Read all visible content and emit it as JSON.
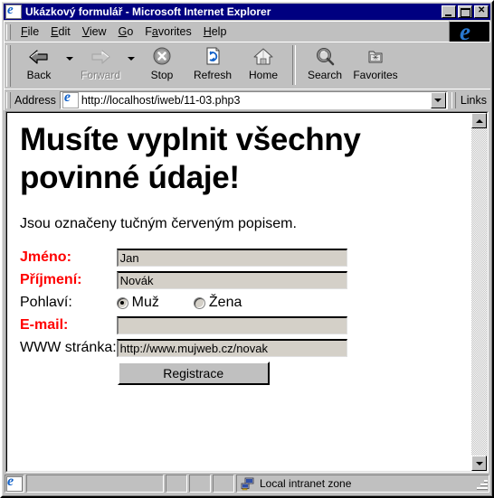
{
  "window": {
    "title": "Ukázkový formulář - Microsoft Internet Explorer",
    "icon": "ie-document-icon",
    "buttons": {
      "minimize": "_",
      "maximize": "□",
      "close": "✕"
    }
  },
  "menubar": {
    "items": [
      {
        "accel": "F",
        "rest": "ile"
      },
      {
        "accel": "E",
        "rest": "dit"
      },
      {
        "accel": "V",
        "rest": "iew"
      },
      {
        "accel": "G",
        "rest": "o"
      },
      {
        "pre": "F",
        "accel": "a",
        "rest": "vorites"
      },
      {
        "accel": "H",
        "rest": "elp"
      }
    ],
    "labels": [
      "File",
      "Edit",
      "View",
      "Go",
      "Favorites",
      "Help"
    ]
  },
  "toolbar": {
    "buttons": [
      {
        "label": "Back",
        "icon": "back-arrow-icon",
        "enabled": true,
        "dropdown": true
      },
      {
        "label": "Forward",
        "icon": "forward-arrow-icon",
        "enabled": false,
        "dropdown": true
      },
      {
        "label": "Stop",
        "icon": "stop-icon",
        "enabled": true,
        "dropdown": false
      },
      {
        "label": "Refresh",
        "icon": "refresh-icon",
        "enabled": true,
        "dropdown": false
      },
      {
        "label": "Home",
        "icon": "home-icon",
        "enabled": true,
        "dropdown": false
      },
      {
        "label": "Search",
        "icon": "search-icon",
        "enabled": true,
        "dropdown": false
      },
      {
        "label": "Favorites",
        "icon": "favorites-folder-icon",
        "enabled": true,
        "dropdown": false
      }
    ]
  },
  "address": {
    "label": "Address",
    "url": "http://localhost/iweb/11-03.php3",
    "links_label": "Links"
  },
  "page": {
    "heading": "Musíte vyplnit všechny povinné údaje!",
    "lead": "Jsou označeny tučným červeným popisem.",
    "fields": [
      {
        "label": "Jméno:",
        "required": true,
        "type": "text",
        "value": "Jan"
      },
      {
        "label": "Příjmení:",
        "required": true,
        "type": "text",
        "value": "Novák"
      },
      {
        "label": "Pohlaví:",
        "required": false,
        "type": "radio",
        "options": [
          {
            "label": "Muž",
            "checked": true
          },
          {
            "label": "Žena",
            "checked": false
          }
        ]
      },
      {
        "label": "E-mail:",
        "required": true,
        "type": "text",
        "value": ""
      },
      {
        "label": "WWW stránka:",
        "required": false,
        "type": "text",
        "value": "http://www.mujweb.cz/novak"
      }
    ],
    "submit_label": "Registrace"
  },
  "statusbar": {
    "message": "",
    "zone": "Local intranet zone",
    "zone_icon": "network-zone-icon",
    "ie_icon": "ie-document-icon"
  },
  "colors": {
    "titlebar": "#000080",
    "required_label": "#ff0000",
    "chrome": "#c0c0c0",
    "page_bg": "#ffffff",
    "input_bg": "#d4d0c8"
  }
}
